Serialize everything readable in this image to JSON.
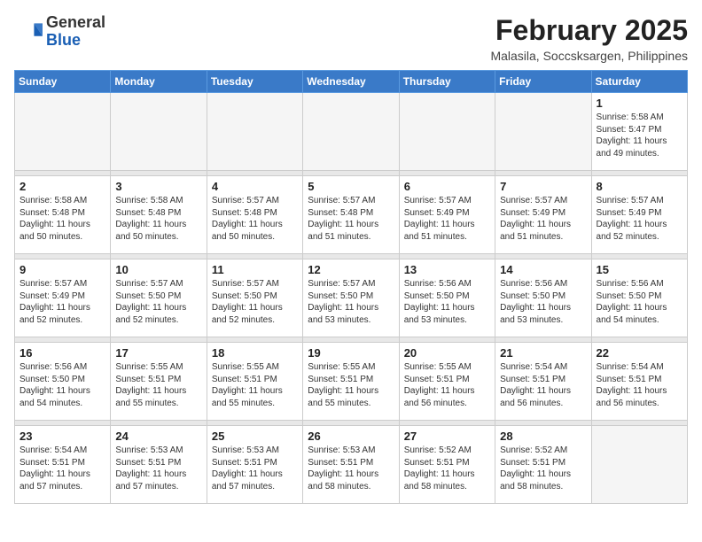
{
  "logo": {
    "line1": "General",
    "line2": "Blue"
  },
  "title": "February 2025",
  "location": "Malasila, Soccsksargen, Philippines",
  "weekdays": [
    "Sunday",
    "Monday",
    "Tuesday",
    "Wednesday",
    "Thursday",
    "Friday",
    "Saturday"
  ],
  "weeks": [
    [
      {
        "day": "",
        "info": ""
      },
      {
        "day": "",
        "info": ""
      },
      {
        "day": "",
        "info": ""
      },
      {
        "day": "",
        "info": ""
      },
      {
        "day": "",
        "info": ""
      },
      {
        "day": "",
        "info": ""
      },
      {
        "day": "1",
        "info": "Sunrise: 5:58 AM\nSunset: 5:47 PM\nDaylight: 11 hours\nand 49 minutes."
      }
    ],
    [
      {
        "day": "2",
        "info": "Sunrise: 5:58 AM\nSunset: 5:48 PM\nDaylight: 11 hours\nand 50 minutes."
      },
      {
        "day": "3",
        "info": "Sunrise: 5:58 AM\nSunset: 5:48 PM\nDaylight: 11 hours\nand 50 minutes."
      },
      {
        "day": "4",
        "info": "Sunrise: 5:57 AM\nSunset: 5:48 PM\nDaylight: 11 hours\nand 50 minutes."
      },
      {
        "day": "5",
        "info": "Sunrise: 5:57 AM\nSunset: 5:48 PM\nDaylight: 11 hours\nand 51 minutes."
      },
      {
        "day": "6",
        "info": "Sunrise: 5:57 AM\nSunset: 5:49 PM\nDaylight: 11 hours\nand 51 minutes."
      },
      {
        "day": "7",
        "info": "Sunrise: 5:57 AM\nSunset: 5:49 PM\nDaylight: 11 hours\nand 51 minutes."
      },
      {
        "day": "8",
        "info": "Sunrise: 5:57 AM\nSunset: 5:49 PM\nDaylight: 11 hours\nand 52 minutes."
      }
    ],
    [
      {
        "day": "9",
        "info": "Sunrise: 5:57 AM\nSunset: 5:49 PM\nDaylight: 11 hours\nand 52 minutes."
      },
      {
        "day": "10",
        "info": "Sunrise: 5:57 AM\nSunset: 5:50 PM\nDaylight: 11 hours\nand 52 minutes."
      },
      {
        "day": "11",
        "info": "Sunrise: 5:57 AM\nSunset: 5:50 PM\nDaylight: 11 hours\nand 52 minutes."
      },
      {
        "day": "12",
        "info": "Sunrise: 5:57 AM\nSunset: 5:50 PM\nDaylight: 11 hours\nand 53 minutes."
      },
      {
        "day": "13",
        "info": "Sunrise: 5:56 AM\nSunset: 5:50 PM\nDaylight: 11 hours\nand 53 minutes."
      },
      {
        "day": "14",
        "info": "Sunrise: 5:56 AM\nSunset: 5:50 PM\nDaylight: 11 hours\nand 53 minutes."
      },
      {
        "day": "15",
        "info": "Sunrise: 5:56 AM\nSunset: 5:50 PM\nDaylight: 11 hours\nand 54 minutes."
      }
    ],
    [
      {
        "day": "16",
        "info": "Sunrise: 5:56 AM\nSunset: 5:50 PM\nDaylight: 11 hours\nand 54 minutes."
      },
      {
        "day": "17",
        "info": "Sunrise: 5:55 AM\nSunset: 5:51 PM\nDaylight: 11 hours\nand 55 minutes."
      },
      {
        "day": "18",
        "info": "Sunrise: 5:55 AM\nSunset: 5:51 PM\nDaylight: 11 hours\nand 55 minutes."
      },
      {
        "day": "19",
        "info": "Sunrise: 5:55 AM\nSunset: 5:51 PM\nDaylight: 11 hours\nand 55 minutes."
      },
      {
        "day": "20",
        "info": "Sunrise: 5:55 AM\nSunset: 5:51 PM\nDaylight: 11 hours\nand 56 minutes."
      },
      {
        "day": "21",
        "info": "Sunrise: 5:54 AM\nSunset: 5:51 PM\nDaylight: 11 hours\nand 56 minutes."
      },
      {
        "day": "22",
        "info": "Sunrise: 5:54 AM\nSunset: 5:51 PM\nDaylight: 11 hours\nand 56 minutes."
      }
    ],
    [
      {
        "day": "23",
        "info": "Sunrise: 5:54 AM\nSunset: 5:51 PM\nDaylight: 11 hours\nand 57 minutes."
      },
      {
        "day": "24",
        "info": "Sunrise: 5:53 AM\nSunset: 5:51 PM\nDaylight: 11 hours\nand 57 minutes."
      },
      {
        "day": "25",
        "info": "Sunrise: 5:53 AM\nSunset: 5:51 PM\nDaylight: 11 hours\nand 57 minutes."
      },
      {
        "day": "26",
        "info": "Sunrise: 5:53 AM\nSunset: 5:51 PM\nDaylight: 11 hours\nand 58 minutes."
      },
      {
        "day": "27",
        "info": "Sunrise: 5:52 AM\nSunset: 5:51 PM\nDaylight: 11 hours\nand 58 minutes."
      },
      {
        "day": "28",
        "info": "Sunrise: 5:52 AM\nSunset: 5:51 PM\nDaylight: 11 hours\nand 58 minutes."
      },
      {
        "day": "",
        "info": ""
      }
    ]
  ]
}
